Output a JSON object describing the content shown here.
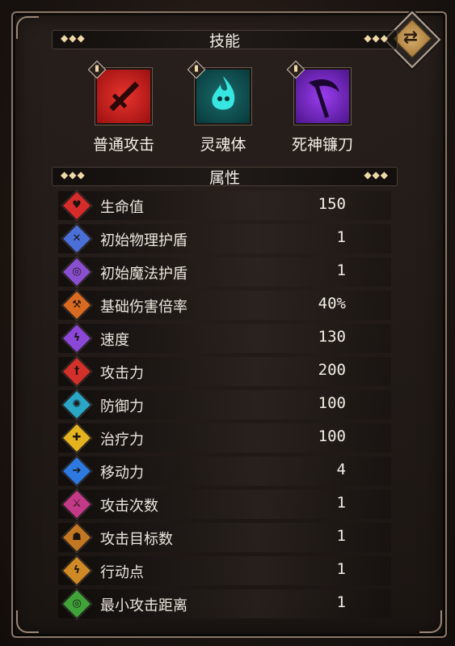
{
  "skills_header": {
    "title": "技能"
  },
  "attributes_header": {
    "title": "属性"
  },
  "skills": [
    {
      "label": "普通攻击",
      "icon": "dagger-icon",
      "bg": "#c81e1e"
    },
    {
      "label": "灵魂体",
      "icon": "spirit-flame-icon",
      "bg": "#12b3b0"
    },
    {
      "label": "死神镰刀",
      "icon": "scythe-icon",
      "bg": "#7a2fc9"
    }
  ],
  "attributes": [
    {
      "name": "生命值",
      "value": "150",
      "icon": "heart-icon",
      "color": "#d62b2b"
    },
    {
      "name": "初始物理护盾",
      "value": "1",
      "icon": "physical-shield-icon",
      "color": "#4a6fd6"
    },
    {
      "name": "初始魔法护盾",
      "value": "1",
      "icon": "magic-shield-icon",
      "color": "#8a4fd0"
    },
    {
      "name": "基础伤害倍率",
      "value": "40%",
      "icon": "damage-rate-icon",
      "color": "#d86a22"
    },
    {
      "name": "速度",
      "value": "130",
      "icon": "speed-icon",
      "color": "#8b48d8"
    },
    {
      "name": "攻击力",
      "value": "200",
      "icon": "attack-icon",
      "color": "#d2302a"
    },
    {
      "name": "防御力",
      "value": "100",
      "icon": "defense-icon",
      "color": "#2aa6c7"
    },
    {
      "name": "治疗力",
      "value": "100",
      "icon": "heal-icon",
      "color": "#e3b41f"
    },
    {
      "name": "移动力",
      "value": "4",
      "icon": "move-icon",
      "color": "#2d79e0"
    },
    {
      "name": "攻击次数",
      "value": "1",
      "icon": "attack-count-icon",
      "color": "#c33a88"
    },
    {
      "name": "攻击目标数",
      "value": "1",
      "icon": "target-count-icon",
      "color": "#c47722"
    },
    {
      "name": "行动点",
      "value": "1",
      "icon": "action-point-icon",
      "color": "#cf8a26"
    },
    {
      "name": "最小攻击距离",
      "value": "1",
      "icon": "range-icon",
      "color": "#3fa33a"
    }
  ]
}
